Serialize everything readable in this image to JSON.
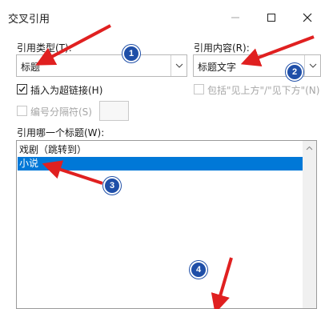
{
  "window": {
    "title": "交叉引用",
    "controls": [
      "minimize-icon",
      "maximize-icon",
      "close-icon"
    ]
  },
  "reference_type": {
    "label": "引用类型(T):",
    "value": "标题"
  },
  "reference_content": {
    "label": "引用内容(R):",
    "value": "标题文字"
  },
  "insert_hyperlink": {
    "label": "插入为超链接(H)",
    "checked": true
  },
  "include_above_below": {
    "label": "包括\"见上方\"/\"见下方\"(N)",
    "checked": false,
    "enabled": false
  },
  "number_separator": {
    "label": "编号分隔符(S)",
    "checked": false,
    "enabled": false,
    "value": ""
  },
  "which_heading": {
    "label": "引用哪一个标题(W):",
    "items": [
      {
        "text": "戏剧（跳转到）",
        "selected": false
      },
      {
        "text": "小说",
        "selected": true
      }
    ]
  },
  "annotations": {
    "badges": [
      "1",
      "2",
      "3",
      "4"
    ],
    "arrow_color": "#e02020",
    "badge_color": "#1f4fa8"
  }
}
